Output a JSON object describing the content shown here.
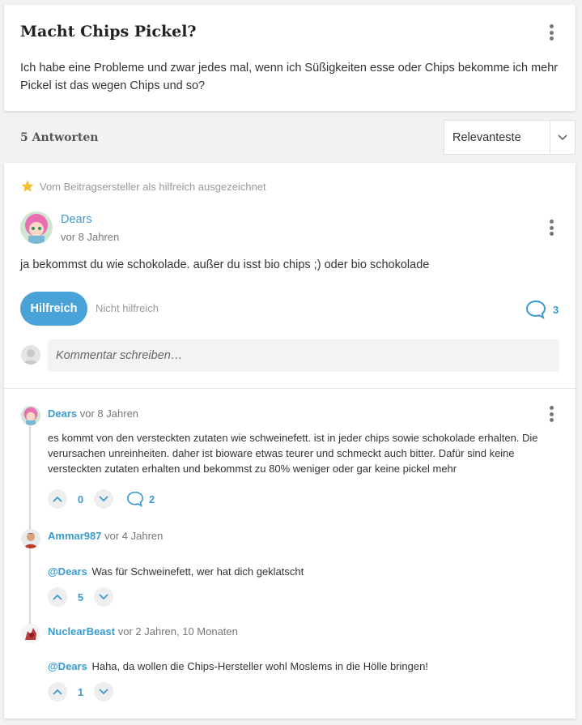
{
  "question": {
    "title": "Macht Chips Pickel?",
    "body": "Ich habe eine Probleme und zwar jedes mal, wenn ich Süßigkeiten esse oder Chips bekomme ich mehr Pickel ist das wegen Chips und so?"
  },
  "answers_header": {
    "count_label": "5 Antworten",
    "sort_value": "Relevanteste"
  },
  "answer": {
    "helpful_badge": "Vom Beitragsersteller als hilfreich ausgezeichnet",
    "author": "Dears",
    "time": "vor 8 Jahren",
    "body": "ja bekommst du wie schokolade. außer du isst bio chips ;) oder bio schokolade",
    "helpful_label": "Hilfreich",
    "not_helpful_label": "Nicht hilfreich",
    "comment_count": "3",
    "comment_placeholder": "Kommentar schreiben…"
  },
  "comments": [
    {
      "author": "Dears",
      "time": "vor 8 Jahren",
      "body": "es kommt von den versteckten zutaten wie schweinefett. ist in jeder chips sowie schokolade erhalten. Die verursachen unreinheiten. daher ist bioware etwas teurer und schmeckt auch bitter. Dafür sind keine versteckten zutaten erhalten und bekommst zu 80% weniger oder gar keine pickel mehr",
      "votes": "0",
      "replies": "2"
    },
    {
      "author": "Ammar987",
      "time": "vor 4 Jahren",
      "mention": "@Dears",
      "body": "Was für Schweinefett, wer hat dich geklatscht",
      "votes": "5"
    },
    {
      "author": "NuclearBeast",
      "time": "vor 2 Jahren, 10 Monaten",
      "mention": "@Dears",
      "body": "Haha, da wollen die Chips-Hersteller wohl Moslems in die Hölle bringen!",
      "votes": "1"
    }
  ],
  "colors": {
    "accent": "#3a9bd0",
    "button": "#4aa3d8",
    "star": "#f2c230"
  },
  "icons": [
    "kebab-menu-icon",
    "chevron-down-icon",
    "star-icon",
    "speech-bubble-icon",
    "chevron-up-icon",
    "user-placeholder-icon"
  ]
}
